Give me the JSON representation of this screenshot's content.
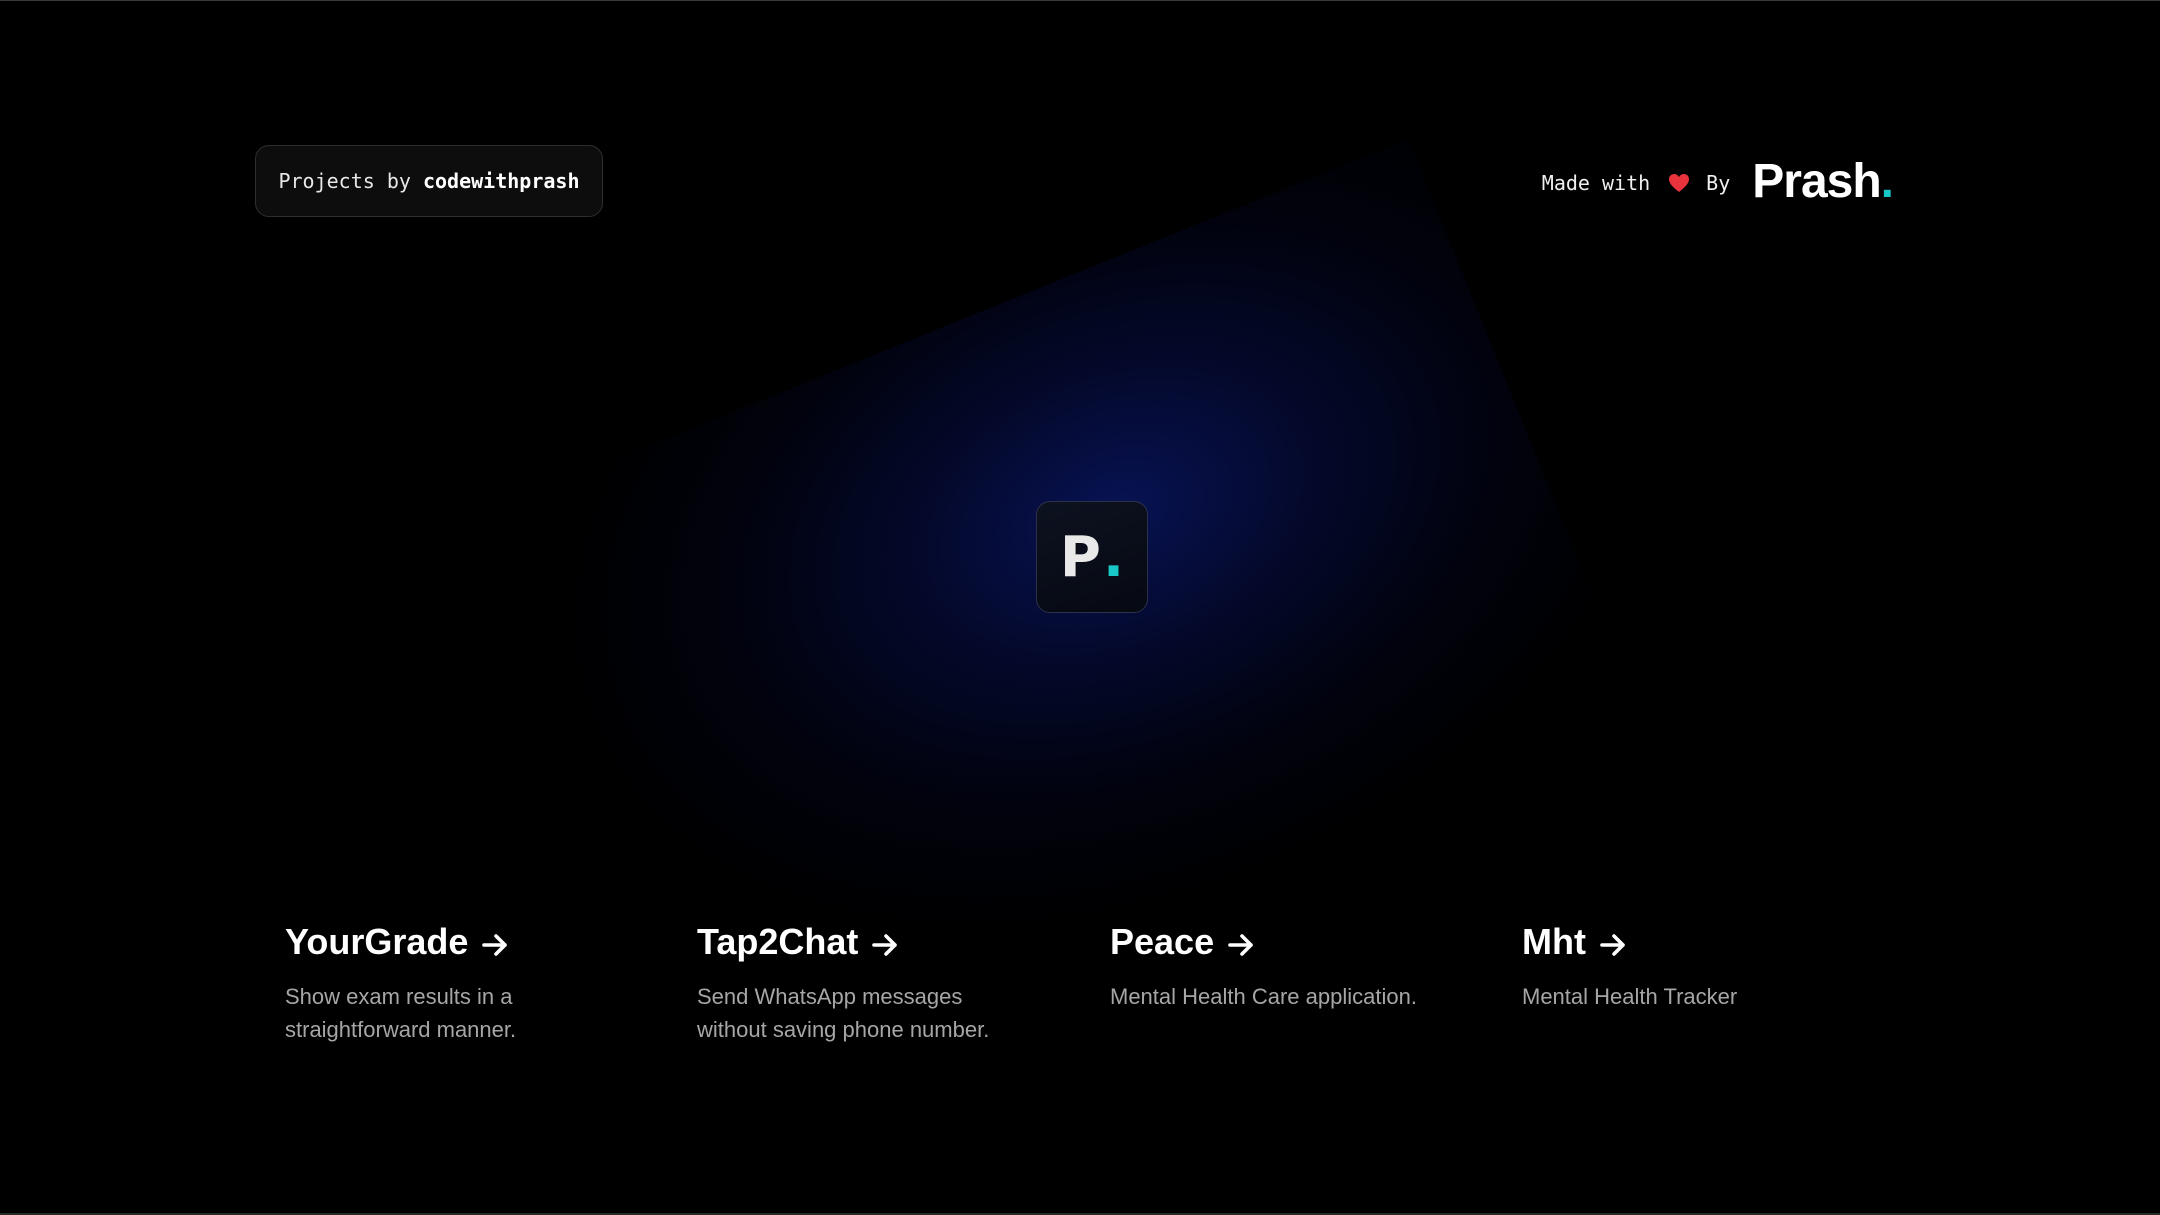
{
  "theme": {
    "background": "#000000",
    "accent": "#18c7c7",
    "heart": "#e8333c",
    "glow": "#0c1e87"
  },
  "header": {
    "badge_prefix": "Projects by ",
    "badge_handle": "codewithprash",
    "made_with_text": "Made with",
    "heart_icon": "heart-icon",
    "by_text": "By",
    "brand_name": "Prash",
    "brand_dot": "."
  },
  "logo": {
    "letter": "P",
    "dot": "."
  },
  "projects": [
    {
      "title": "YourGrade",
      "description_line1": "Show exam results in a",
      "description_line2": "straightforward manner.",
      "icon": "arrow-right-icon"
    },
    {
      "title": "Tap2Chat",
      "description_line1": "Send WhatsApp messages",
      "description_line2": "without saving phone number.",
      "icon": "arrow-right-icon"
    },
    {
      "title": "Peace",
      "description_line1": "Mental Health Care application.",
      "description_line2": "",
      "icon": "arrow-right-icon"
    },
    {
      "title": "Mht",
      "description_line1": "Mental Health Tracker",
      "description_line2": "",
      "icon": "arrow-right-icon"
    }
  ]
}
